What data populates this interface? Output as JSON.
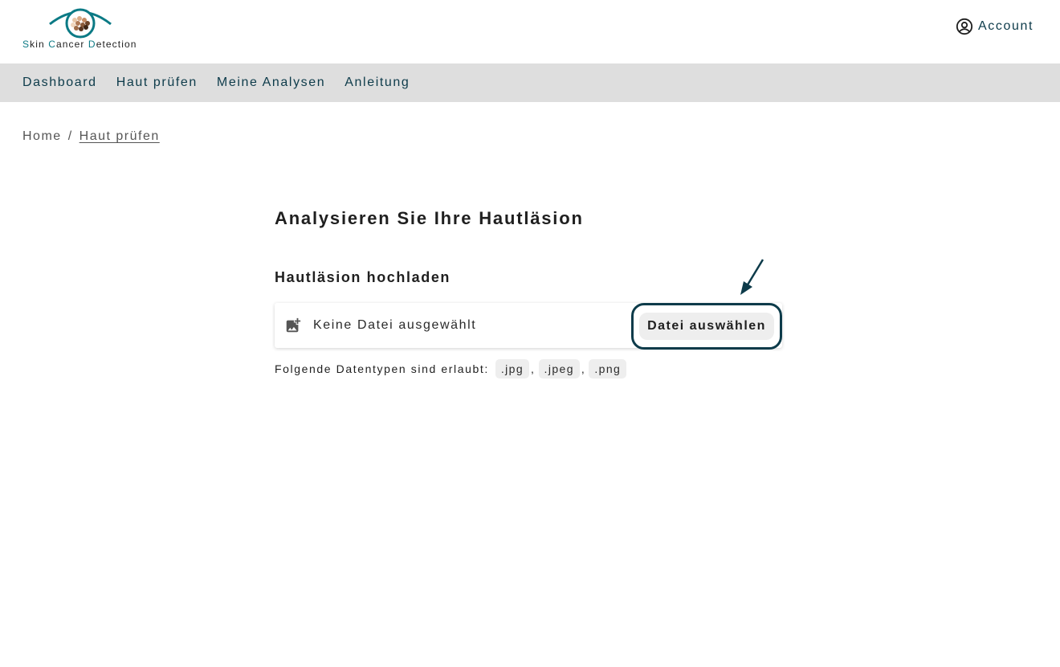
{
  "brand": {
    "logo_text_parts": [
      "S",
      "kin ",
      "C",
      "ancer ",
      "D",
      "etection"
    ],
    "logo_icon": "eye-icon",
    "accent_color": "#0b7a85"
  },
  "header": {
    "account_label": "Account",
    "account_icon": "user-circle-icon"
  },
  "nav": {
    "items": [
      {
        "label": "Dashboard"
      },
      {
        "label": "Haut prüfen"
      },
      {
        "label": "Meine Analysen"
      },
      {
        "label": "Anleitung"
      }
    ]
  },
  "breadcrumb": {
    "home": "Home",
    "separator": "/",
    "current": "Haut prüfen"
  },
  "main": {
    "title": "Analysieren Sie Ihre Hautläsion",
    "upload_section_title": "Hautläsion hochladen",
    "upload_icon": "add-image-icon",
    "file_status": "Keine Datei ausgewählt",
    "choose_button_label": "Datei auswählen",
    "allowed_label": "Folgende Datentypen sind erlaubt:",
    "allowed_types": [
      ".jpg",
      ".jpeg",
      ".png"
    ],
    "type_separator": ",",
    "highlight_color": "#0d3b4a",
    "annotation_icon": "arrow-pointer-icon"
  }
}
